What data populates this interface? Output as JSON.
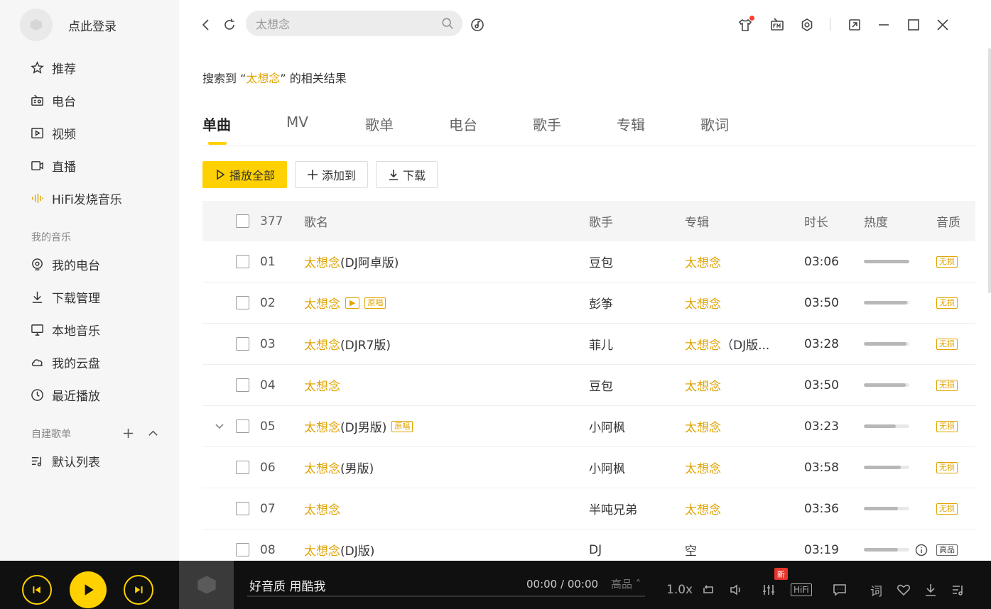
{
  "sidebar": {
    "login_label": "点此登录",
    "nav": [
      {
        "label": "推荐",
        "icon": "star-icon"
      },
      {
        "label": "电台",
        "icon": "radio-icon"
      },
      {
        "label": "视频",
        "icon": "video-icon"
      },
      {
        "label": "直播",
        "icon": "live-icon"
      },
      {
        "label": "HiFi发烧音乐",
        "icon": "sound-wave-icon"
      }
    ],
    "my_music_title": "我的音乐",
    "my_music": [
      {
        "label": "我的电台",
        "icon": "my-radio-icon"
      },
      {
        "label": "下载管理",
        "icon": "download-icon"
      },
      {
        "label": "本地音乐",
        "icon": "monitor-icon"
      },
      {
        "label": "我的云盘",
        "icon": "cloud-icon"
      },
      {
        "label": "最近播放",
        "icon": "clock-icon"
      }
    ],
    "playlists_title": "自建歌单",
    "playlists": [
      {
        "label": "默认列表",
        "icon": "playlist-icon"
      }
    ]
  },
  "search": {
    "value": "太想念",
    "placeholder": "太想念"
  },
  "result": {
    "prefix": "搜索到 “",
    "keyword": "太想念",
    "suffix": "” 的相关结果"
  },
  "tabs": [
    "单曲",
    "MV",
    "歌单",
    "电台",
    "歌手",
    "专辑",
    "歌词"
  ],
  "actions": {
    "play_all": "播放全部",
    "add_to": "添加到",
    "download": "下载"
  },
  "table": {
    "count": "377",
    "headers": {
      "title": "歌名",
      "artist": "歌手",
      "album": "专辑",
      "duration": "时长",
      "heat": "热度",
      "quality": "音质"
    },
    "rows": [
      {
        "num": "01",
        "title": "太想念",
        "suffix": "(DJ阿卓版)",
        "tags": [],
        "artist": "豆包",
        "album": "太想念",
        "album_suffix": "",
        "duration": "03:06",
        "heat": 1.0,
        "quality": "无损",
        "album_gold": true
      },
      {
        "num": "02",
        "title": "太想念",
        "suffix": "",
        "tags": [
          "▶",
          "原唱"
        ],
        "artist": "彭筝",
        "album": "太想念",
        "album_suffix": "",
        "duration": "03:50",
        "heat": 0.96,
        "quality": "无损",
        "album_gold": true
      },
      {
        "num": "03",
        "title": "太想念",
        "suffix": "(DJR7版)",
        "tags": [],
        "artist": "菲儿",
        "album": "太想念",
        "album_suffix": "（DJ版...",
        "duration": "03:28",
        "heat": 0.94,
        "quality": "无损",
        "album_gold": true
      },
      {
        "num": "04",
        "title": "太想念",
        "suffix": "",
        "tags": [],
        "artist": "豆包",
        "album": "太想念",
        "album_suffix": "",
        "duration": "03:50",
        "heat": 0.92,
        "quality": "无损",
        "album_gold": true
      },
      {
        "num": "05",
        "title": "太想念",
        "suffix": "(DJ男版)",
        "tags": [
          "原唱"
        ],
        "artist": "小阿枫",
        "album": "太想念",
        "album_suffix": "",
        "duration": "03:23",
        "heat": 0.7,
        "quality": "无损",
        "album_gold": true
      },
      {
        "num": "06",
        "title": "太想念",
        "suffix": "(男版)",
        "tags": [],
        "artist": "小阿枫",
        "album": "太想念",
        "album_suffix": "",
        "duration": "03:58",
        "heat": 0.82,
        "quality": "无损",
        "album_gold": true
      },
      {
        "num": "07",
        "title": "太想念",
        "suffix": "",
        "tags": [],
        "artist": "半吨兄弟",
        "album": "太想念",
        "album_suffix": "",
        "duration": "03:36",
        "heat": 0.75,
        "quality": "无损",
        "album_gold": true
      },
      {
        "num": "08",
        "title": "太想念",
        "suffix": " (DJ版)",
        "tags": [],
        "artist": "DJ",
        "album": "空",
        "album_suffix": "",
        "duration": "03:19",
        "heat": 0.75,
        "quality": "高品",
        "album_gold": false
      }
    ]
  },
  "player": {
    "song_info": "好音质 用酷我",
    "time": "00:00 / 00:00",
    "quality": "高品 ˄",
    "speed": "1.0x",
    "hifi": "HiFi",
    "new_badge": "新",
    "lyrics": "词"
  },
  "colors": {
    "accent": "#ffd100",
    "link": "#e0a300",
    "player_bg": "#101010"
  }
}
